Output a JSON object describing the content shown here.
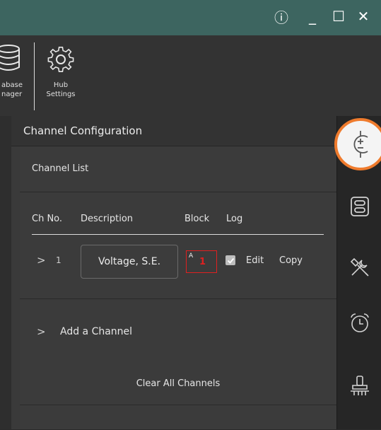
{
  "window": {
    "info_glyph": "ⓘ",
    "minimize_glyph": "_",
    "maximize_glyph": "☐",
    "close_glyph": "✕"
  },
  "toolbar": {
    "database_manager": {
      "line1": "abase",
      "line2": "nager",
      "icon": "database-icon"
    },
    "hub_settings": {
      "line1": "Hub",
      "line2": "Settings",
      "icon": "gear-icon"
    }
  },
  "panel": {
    "title": "Channel Configuration",
    "channel_list_label": "Channel List",
    "columns": [
      "Ch No.",
      "Description",
      "Block",
      "Log"
    ],
    "row": {
      "expand_glyph": ">",
      "ch_no": "1",
      "description": "Voltage, S.E.",
      "block_letter": "A",
      "block_number": "1",
      "log_checked": true,
      "edit_label": "Edit",
      "copy_label": "Copy"
    },
    "add_channel": {
      "glyph": ">",
      "label": "Add a Channel"
    },
    "clear_all_label": "Clear All Channels"
  },
  "rail": {
    "items": [
      "channel-config-icon",
      "hub-module-icon",
      "tools-icon",
      "alarm-icon",
      "plunger-icon"
    ],
    "active": "channel-config-icon",
    "highlight_color": "#ef7b2d"
  },
  "colors": {
    "titlebar": "#3d6560",
    "accent_red": "#e02020"
  }
}
